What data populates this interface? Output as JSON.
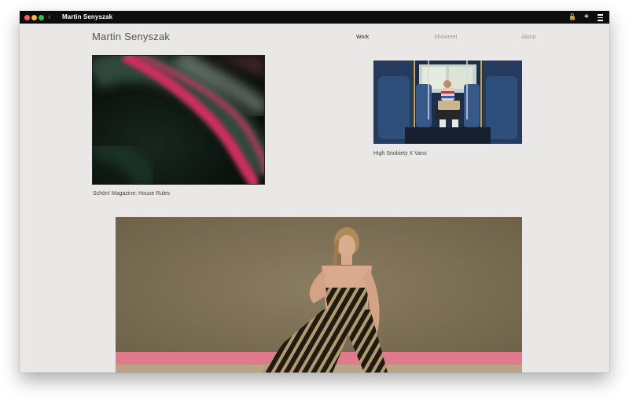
{
  "window": {
    "title": "Martin Senyszak",
    "back_glyph": "‹",
    "lock_glyph": "🔓",
    "plus_glyph": "+"
  },
  "site": {
    "logo": "Martin Senyszak",
    "nav": [
      {
        "label": "Work",
        "active": true
      },
      {
        "label": "Showreel",
        "active": false
      },
      {
        "label": "About",
        "active": false
      }
    ]
  },
  "projects": [
    {
      "caption": "Schön! Magazine: House Rules"
    },
    {
      "caption": "High Snobiety X Vans"
    },
    {
      "caption": ""
    }
  ],
  "colors": {
    "page_bg": "#e9e8e6",
    "titlebar": "#0d0d0d",
    "accent_pink": "#d2366a"
  }
}
